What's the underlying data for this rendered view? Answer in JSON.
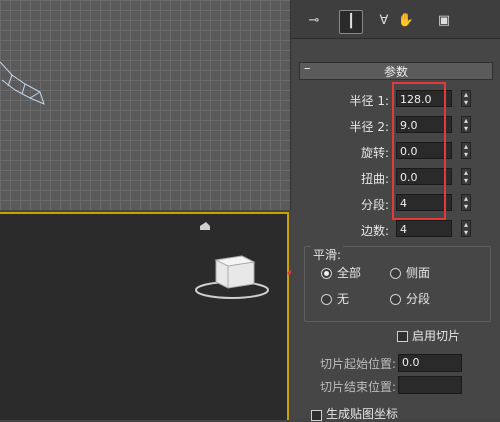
{
  "toolbar": {
    "buttons": [
      "pin-icon",
      "modifier-stack-icon",
      "fork-icon",
      "hand-icon",
      "configure-icon"
    ]
  },
  "parameters": {
    "title": "参数",
    "collapse_symbol": "–",
    "rows": [
      {
        "label": "半径 1:",
        "value": "128.0"
      },
      {
        "label": "半径 2:",
        "value": "9.0"
      },
      {
        "label": "旋转:",
        "value": "0.0"
      },
      {
        "label": "扭曲:",
        "value": "0.0"
      },
      {
        "label": "分段:",
        "value": "4"
      },
      {
        "label": "边数:",
        "value": "4"
      }
    ]
  },
  "smoothing": {
    "title": "平滑:",
    "options": [
      "全部",
      "侧面",
      "无",
      "分段"
    ],
    "selected": "全部"
  },
  "slice": {
    "enable_label": "启用切片",
    "start_label": "切片起始位置:",
    "start_value": "0.0",
    "end_label": "切片结束位置:",
    "mapping_label": "生成贴图坐标"
  },
  "colors": {
    "highlight_box": "#e23a3a",
    "active_viewport_border": "#c8a000"
  }
}
